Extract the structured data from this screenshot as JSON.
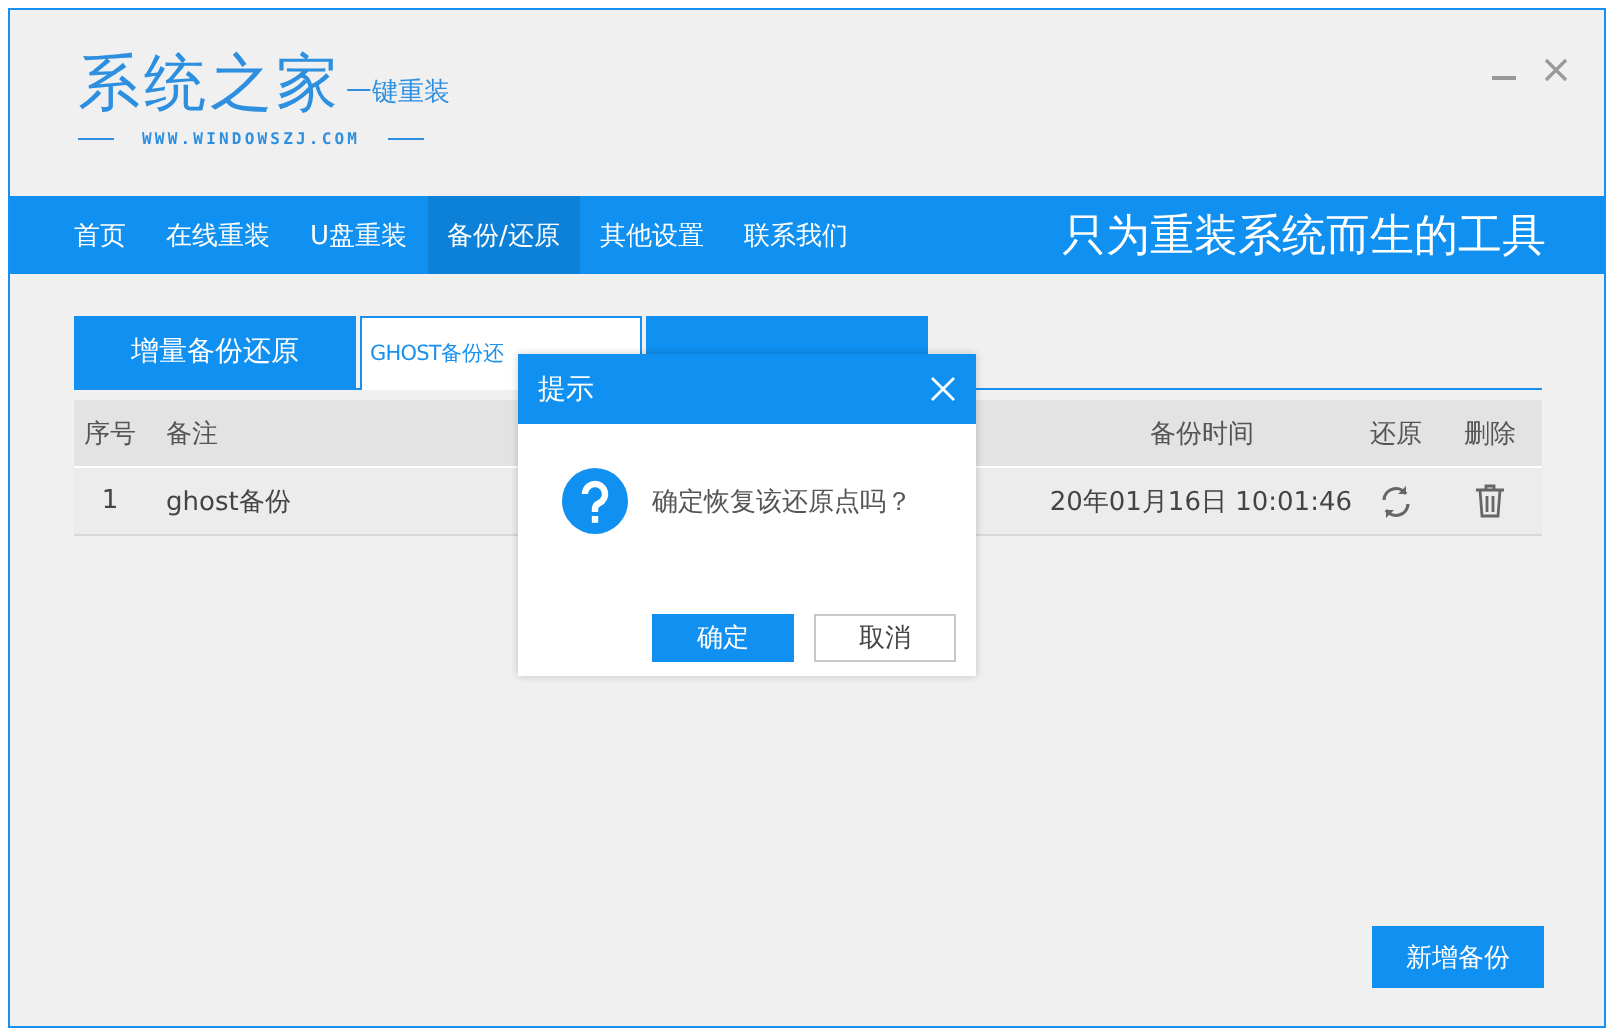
{
  "logo": {
    "title": "系统之家",
    "subtitle": "一键重装",
    "url": "WWW.WINDOWSZJ.COM"
  },
  "nav": {
    "items": [
      {
        "label": "首页",
        "selected": false
      },
      {
        "label": "在线重装",
        "selected": false
      },
      {
        "label": "U盘重装",
        "selected": false
      },
      {
        "label": "备份/还原",
        "selected": true
      },
      {
        "label": "其他设置",
        "selected": false
      },
      {
        "label": "联系我们",
        "selected": false
      }
    ],
    "slogan": "只为重装系统而生的工具"
  },
  "tabs": [
    {
      "label": "增量备份还原",
      "selected": false
    },
    {
      "label": "GHOST备份还",
      "selected": true
    },
    {
      "selected": false
    }
  ],
  "table": {
    "columns": [
      "序号",
      "备注",
      "备份时间",
      "还原",
      "删除"
    ],
    "rows": [
      {
        "index": "1",
        "note": "ghost备份",
        "time": "20年01月16日 10:01:46"
      }
    ]
  },
  "dialog": {
    "title": "提示",
    "message": "确定恢复该还原点吗？",
    "buttons": [
      {
        "label": "确定",
        "kind": "primary"
      },
      {
        "label": "取消",
        "kind": "secondary"
      }
    ]
  },
  "add_button": "新增备份"
}
